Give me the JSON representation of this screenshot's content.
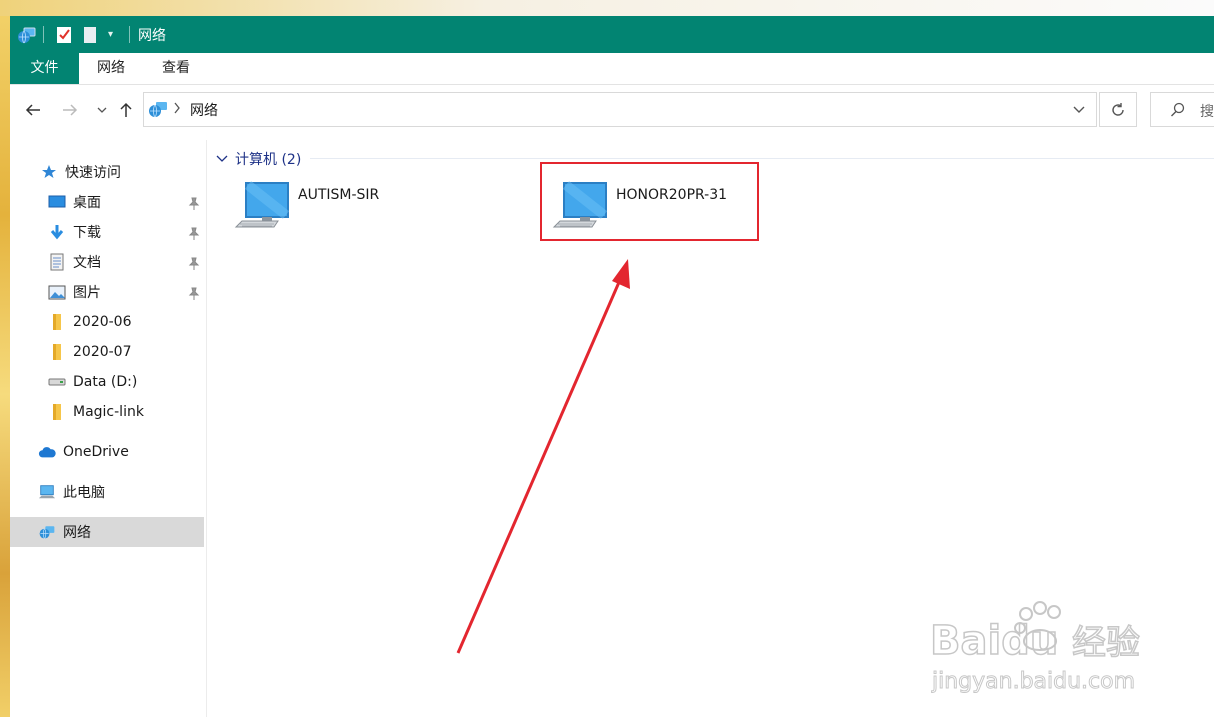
{
  "window": {
    "title": "网络",
    "accent": "#028472"
  },
  "ribbon": {
    "tabs": [
      "文件",
      "网络",
      "查看"
    ]
  },
  "address": {
    "crumb": "网络",
    "search_placeholder": "搜"
  },
  "sidebar": {
    "quick_access": "快速访问",
    "items": [
      {
        "label": "桌面",
        "icon": "desktop-icon",
        "pinned": true
      },
      {
        "label": "下载",
        "icon": "download-icon",
        "pinned": true
      },
      {
        "label": "文档",
        "icon": "document-icon",
        "pinned": true
      },
      {
        "label": "图片",
        "icon": "pictures-icon",
        "pinned": true
      },
      {
        "label": "2020-06",
        "icon": "folder-icon",
        "pinned": false
      },
      {
        "label": "2020-07",
        "icon": "folder-icon",
        "pinned": false
      },
      {
        "label": "Data (D:)",
        "icon": "drive-icon",
        "pinned": false
      },
      {
        "label": "Magic-link",
        "icon": "folder-icon",
        "pinned": false
      }
    ],
    "onedrive": "OneDrive",
    "this_pc": "此电脑",
    "network": "网络"
  },
  "content": {
    "group_label": "计算机 (2)",
    "computers": [
      "AUTISM-SIR",
      "HONOR20PR-31"
    ]
  },
  "annotation": {
    "color": "#e3262f"
  },
  "watermark": {
    "brand": "Baidu",
    "brand_cn": "经验",
    "url": "jingyan.baidu.com"
  }
}
